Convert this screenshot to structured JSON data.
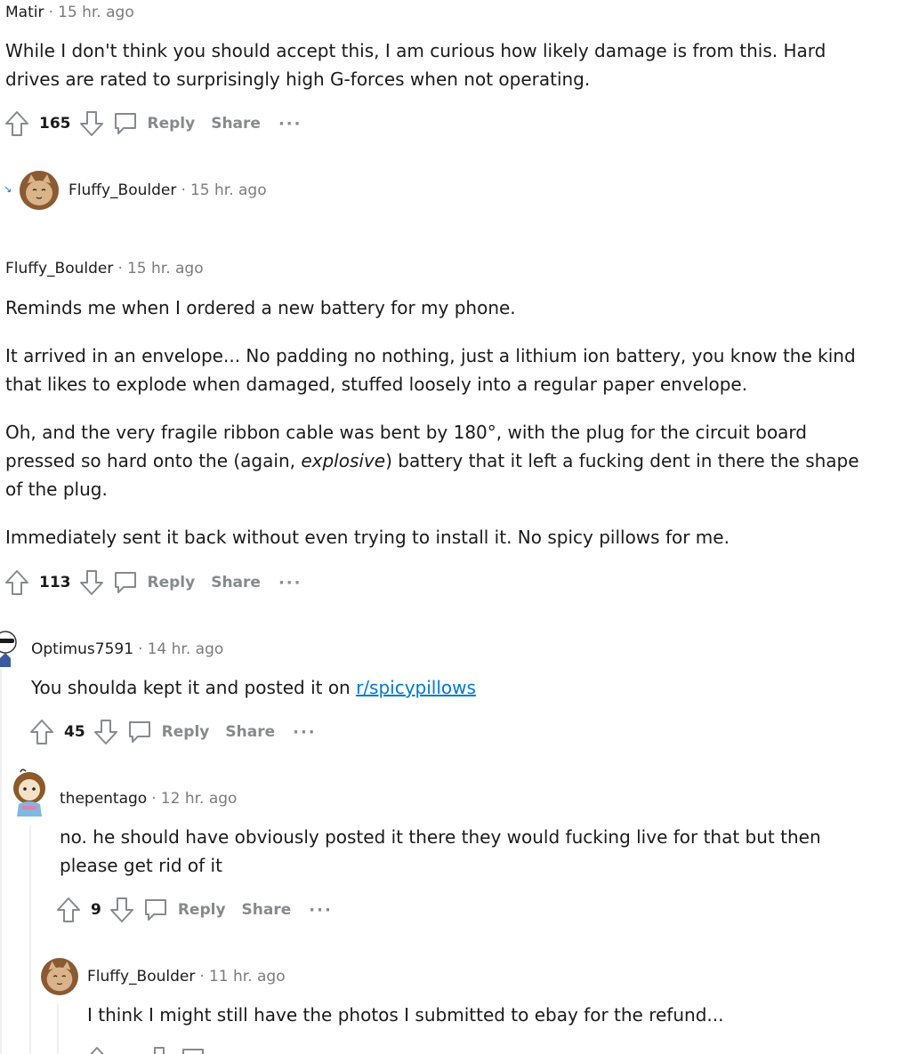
{
  "comments": [
    {
      "author": "Matir",
      "separator": "·",
      "time": "15 hr. ago",
      "body": [
        "While I don't think you should accept this, I am curious how likely damage is from this. Hard drives are rated to surprisingly high G-forces when not operating."
      ],
      "votes": "165",
      "reply_label": "Reply",
      "share_label": "Share",
      "more_label": "···"
    },
    {
      "collapsed_arrow": "↘",
      "author": "Fluffy_Boulder",
      "separator": "·",
      "time": "15 hr. ago"
    },
    {
      "author": "Fluffy_Boulder",
      "separator": "·",
      "time": "15 hr. ago",
      "body_p1": "Reminds me when I ordered a new battery for my phone.",
      "body_p2": "It arrived in an envelope... No padding no nothing, just a lithium ion battery, you know the kind that likes to explode when damaged, stuffed loosely into a regular paper envelope.",
      "body_p3_pre": "Oh, and the very fragile ribbon cable was bent by 180°, with the plug for the circuit board pressed so hard onto the (again, ",
      "body_p3_em": "explosive",
      "body_p3_post": ") battery that it left a fucking dent in there the shape of the plug.",
      "body_p4": "Immediately sent it back without even trying to install it. No spicy pillows for me.",
      "votes": "113",
      "reply_label": "Reply",
      "share_label": "Share",
      "more_label": "···"
    },
    {
      "author": "Optimus7591",
      "separator": "·",
      "time": "14 hr. ago",
      "body_pre": "You shoulda kept it and posted it on ",
      "body_link": "r/spicypillows",
      "votes": "45",
      "reply_label": "Reply",
      "share_label": "Share",
      "more_label": "···"
    },
    {
      "author": "thepentago",
      "separator": "·",
      "time": "12 hr. ago",
      "body": "no. he should have obviously posted it there they would fucking live for that but then please get rid of it",
      "votes": "9",
      "reply_label": "Reply",
      "share_label": "Share",
      "more_label": "···"
    },
    {
      "author": "Fluffy_Boulder",
      "separator": "·",
      "time": "11 hr. ago",
      "body": "I think I might still have the photos I submitted to ebay for the refund..."
    }
  ],
  "colors": {
    "link": "#0079d3",
    "action_gray": "#878a8c",
    "thread_line": "#edeff1"
  }
}
